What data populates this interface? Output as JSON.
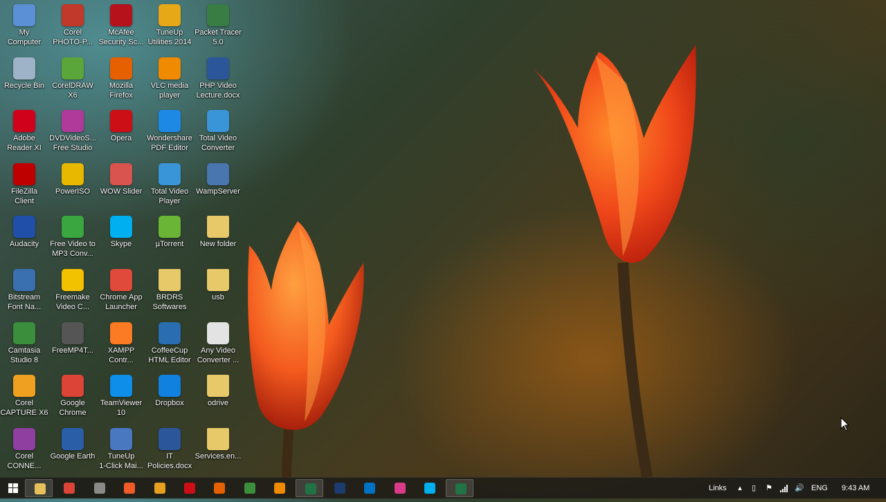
{
  "desktop_icons": [
    {
      "label": "My\nComputer",
      "icon": "computer-icon",
      "color": "#5b8fd6"
    },
    {
      "label": "Corel\nPHOTO-P...",
      "icon": "corel-photopaint-icon",
      "color": "#c0392b"
    },
    {
      "label": "McAfee\nSecurity Sc...",
      "icon": "mcafee-icon",
      "color": "#b5121b"
    },
    {
      "label": "TuneUp\nUtilities 2014",
      "icon": "tuneup-icon",
      "color": "#e6a817"
    },
    {
      "label": "Packet Tracer\n5.0",
      "icon": "packet-tracer-icon",
      "color": "#3a7d44"
    },
    {
      "label": "Recycle Bin",
      "icon": "recycle-bin-icon",
      "color": "#9fb3c8"
    },
    {
      "label": "CorelDRAW\nX6",
      "icon": "coreldraw-icon",
      "color": "#5aa63a"
    },
    {
      "label": "Mozilla\nFirefox",
      "icon": "firefox-icon",
      "color": "#e66000"
    },
    {
      "label": "VLC media\nplayer",
      "icon": "vlc-icon",
      "color": "#f08a00"
    },
    {
      "label": "PHP Video\nLecture.docx",
      "icon": "word-document-icon",
      "color": "#2b579a"
    },
    {
      "label": "Adobe\nReader XI",
      "icon": "adobe-reader-icon",
      "color": "#d0021b"
    },
    {
      "label": "DVDVideoS...\nFree Studio",
      "icon": "dvdvideosoft-icon",
      "color": "#b03a9a"
    },
    {
      "label": "Opera",
      "icon": "opera-icon",
      "color": "#cc0f16"
    },
    {
      "label": "Wondershare\nPDF Editor",
      "icon": "wondershare-pdf-icon",
      "color": "#1e88e5"
    },
    {
      "label": "Total Video\nConverter",
      "icon": "total-video-converter-icon",
      "color": "#3a95d8"
    },
    {
      "label": "FileZilla\nClient",
      "icon": "filezilla-icon",
      "color": "#bf0000"
    },
    {
      "label": "PowerISO",
      "icon": "poweriso-icon",
      "color": "#e8b800"
    },
    {
      "label": "WOW Slider",
      "icon": "wow-slider-icon",
      "color": "#d9534f"
    },
    {
      "label": "Total Video\nPlayer",
      "icon": "total-video-player-icon",
      "color": "#3a95d8"
    },
    {
      "label": "WampServer",
      "icon": "wampserver-icon",
      "color": "#4a76b0"
    },
    {
      "label": "Audacity",
      "icon": "audacity-icon",
      "color": "#1f4fa8"
    },
    {
      "label": "Free Video to\nMP3 Conv...",
      "icon": "free-video-mp3-icon",
      "color": "#3aa640"
    },
    {
      "label": "Skype",
      "icon": "skype-icon",
      "color": "#00aff0"
    },
    {
      "label": "µTorrent",
      "icon": "utorrent-icon",
      "color": "#6ab536"
    },
    {
      "label": "New folder",
      "icon": "folder-icon",
      "color": "#e8c96a"
    },
    {
      "label": "Bitstream\nFont Na...",
      "icon": "bitstream-font-icon",
      "color": "#3a6fb0"
    },
    {
      "label": "Freemake\nVideo C...",
      "icon": "freemake-icon",
      "color": "#f2c200"
    },
    {
      "label": "Chrome App\nLauncher",
      "icon": "chrome-app-launcher-icon",
      "color": "#e04a3a"
    },
    {
      "label": "BRDRS\nSoftwares",
      "icon": "folder-icon",
      "color": "#e8c96a"
    },
    {
      "label": "usb",
      "icon": "folder-icon",
      "color": "#e8c96a"
    },
    {
      "label": "Camtasia\nStudio 8",
      "icon": "camtasia-icon",
      "color": "#3b8e3b"
    },
    {
      "label": "FreeMP4T...",
      "icon": "freemp4-icon",
      "color": "#555555"
    },
    {
      "label": "XAMPP\nContr...",
      "icon": "xampp-icon",
      "color": "#fb7a24"
    },
    {
      "label": "CoffeeCup\nHTML Editor",
      "icon": "coffeecup-icon",
      "color": "#2a6db0"
    },
    {
      "label": "Any Video\nConverter ...",
      "icon": "any-video-converter-icon",
      "color": "#e3e3e3"
    },
    {
      "label": "Corel\nCAPTURE X6",
      "icon": "corel-capture-icon",
      "color": "#f0a020"
    },
    {
      "label": "Google\nChrome",
      "icon": "chrome-icon",
      "color": "#db4437"
    },
    {
      "label": "TeamViewer\n10",
      "icon": "teamviewer-icon",
      "color": "#0e8ee9"
    },
    {
      "label": "Dropbox",
      "icon": "dropbox-icon",
      "color": "#1081de"
    },
    {
      "label": "odrive",
      "icon": "folder-icon",
      "color": "#e8c96a"
    },
    {
      "label": "Corel\nCONNE...",
      "icon": "corel-connect-icon",
      "color": "#8e3fa0"
    },
    {
      "label": "Google Earth",
      "icon": "google-earth-icon",
      "color": "#2a5fa8"
    },
    {
      "label": "TuneUp\n1-Click Mai...",
      "icon": "tuneup-1click-icon",
      "color": "#4a78c0"
    },
    {
      "label": "IT\nPolicies.docx",
      "icon": "word-document-icon",
      "color": "#2b579a"
    },
    {
      "label": "Services.en...",
      "icon": "folder-icon",
      "color": "#e8c96a"
    }
  ],
  "taskbar": {
    "start_icon": "windows-logo-icon",
    "items": [
      {
        "icon": "file-explorer-icon",
        "color": "#e6c15a",
        "active": true
      },
      {
        "icon": "chrome-icon",
        "color": "#db4437",
        "active": false
      },
      {
        "icon": "tablet-app-icon",
        "color": "#8a8a8a",
        "active": false
      },
      {
        "icon": "sublime-icon",
        "color": "#f05a28",
        "active": false
      },
      {
        "icon": "media-player-icon",
        "color": "#e8a020",
        "active": false
      },
      {
        "icon": "opera-icon",
        "color": "#cc0f16",
        "active": false
      },
      {
        "icon": "firefox-icon",
        "color": "#e66000",
        "active": false
      },
      {
        "icon": "camtasia-icon",
        "color": "#3b8e3b",
        "active": false
      },
      {
        "icon": "vlc-icon",
        "color": "#f08a00",
        "active": false
      },
      {
        "icon": "excel-icon",
        "color": "#217346",
        "active": true
      },
      {
        "icon": "photoshop-icon",
        "color": "#1c3b6e",
        "active": false
      },
      {
        "icon": "outlook-icon",
        "color": "#0072c6",
        "active": false
      },
      {
        "icon": "pinwheel-app-icon",
        "color": "#d93a8a",
        "active": false
      },
      {
        "icon": "skype-icon",
        "color": "#00aff0",
        "active": false
      },
      {
        "icon": "excel-icon",
        "color": "#217346",
        "active": true
      }
    ]
  },
  "tray": {
    "links_label": "Links",
    "language": "ENG",
    "time": "9:43 AM",
    "icons": [
      "chevron-up-icon",
      "phone-link-icon",
      "network-flag-icon",
      "signal-bars-icon",
      "volume-icon"
    ]
  }
}
